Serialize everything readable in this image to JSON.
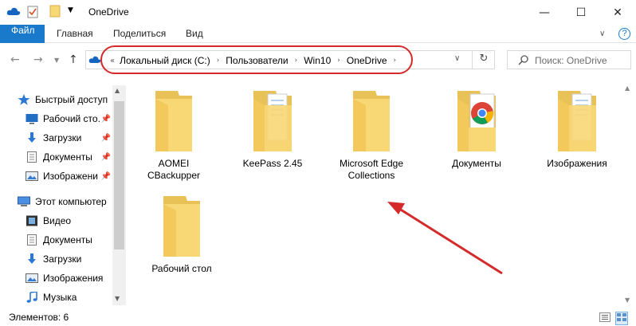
{
  "window": {
    "title": "OneDrive",
    "minimize_glyph": "—",
    "maximize_glyph": "☐",
    "close_glyph": "✕"
  },
  "ribbon": {
    "tabs": [
      "Файл",
      "Главная",
      "Поделиться",
      "Вид"
    ],
    "help_glyph": "?"
  },
  "nav": {
    "breadcrumb": [
      "Локальный диск (C:)",
      "Пользователи",
      "Win10",
      "OneDrive"
    ],
    "search_placeholder": "Поиск: OneDrive"
  },
  "sidebar": {
    "items": [
      {
        "label": "Быстрый доступ",
        "icon": "star-icon",
        "pinned": false
      },
      {
        "label": "Рабочий сто.",
        "icon": "desktop-icon",
        "pinned": true
      },
      {
        "label": "Загрузки",
        "icon": "download-icon",
        "pinned": true
      },
      {
        "label": "Документы",
        "icon": "document-icon",
        "pinned": true
      },
      {
        "label": "Изображени",
        "icon": "pictures-icon",
        "pinned": true
      },
      {
        "label": "Этот компьютер",
        "icon": "computer-icon",
        "pinned": false
      },
      {
        "label": "Видео",
        "icon": "video-icon",
        "pinned": false
      },
      {
        "label": "Документы",
        "icon": "document-icon",
        "pinned": false
      },
      {
        "label": "Загрузки",
        "icon": "download-icon",
        "pinned": false
      },
      {
        "label": "Изображения",
        "icon": "pictures-icon",
        "pinned": false
      },
      {
        "label": "Музыка",
        "icon": "music-icon",
        "pinned": false
      }
    ]
  },
  "files": [
    {
      "line1": "AOMEI",
      "line2": "CBackupper",
      "type": "folder"
    },
    {
      "line1": "KeePass 2.45",
      "line2": "",
      "type": "folder-docs"
    },
    {
      "line1": "Microsoft Edge",
      "line2": "Collections",
      "type": "folder"
    },
    {
      "line1": "Документы",
      "line2": "",
      "type": "folder-chrome"
    },
    {
      "line1": "Изображения",
      "line2": "",
      "type": "folder-docs"
    },
    {
      "line1": "Рабочий стол",
      "line2": "",
      "type": "folder"
    }
  ],
  "status": {
    "count": "Элементов: 6"
  },
  "colors": {
    "accent": "#1979ca",
    "annotation_red": "#d52a2a",
    "folder": "#f8d775"
  }
}
